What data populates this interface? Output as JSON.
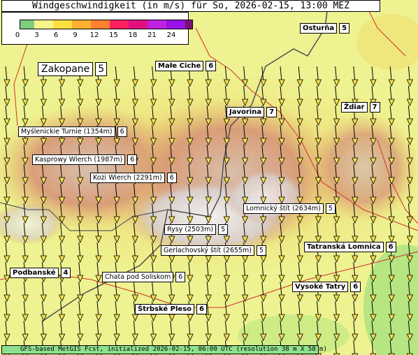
{
  "title": "Windgeschwindigkeit (in m/s) für So, 2026-02-15, 13:00 MEZ",
  "legend": {
    "ticks": [
      "0",
      "3",
      "6",
      "9",
      "12",
      "15",
      "18",
      "21",
      "24"
    ],
    "colors": [
      "#7ccd7c",
      "#f5f58c",
      "#ffe040",
      "#ffb030",
      "#ff8030",
      "#ff2060",
      "#e01080",
      "#c020e0",
      "#9a10e8",
      "#7a1070"
    ]
  },
  "places": [
    {
      "name": "Osturňa",
      "value": "5",
      "type": "town"
    },
    {
      "name": "Małe Ciche",
      "value": "6",
      "type": "town"
    },
    {
      "name": "Zakopane",
      "value": "5",
      "type": "big"
    },
    {
      "name": "Javorina",
      "value": "7",
      "type": "town"
    },
    {
      "name": "Ždiar",
      "value": "7",
      "type": "town"
    },
    {
      "name": "Myślenickie Turnie (1354m)",
      "value": "6",
      "type": "peak"
    },
    {
      "name": "Kasprowy Wierch (1987m)",
      "value": "6",
      "type": "peak"
    },
    {
      "name": "Kozi Wierch (2291m)",
      "value": "6",
      "type": "peak"
    },
    {
      "name": "Lomnický štít (2634m)",
      "value": "5",
      "type": "peak"
    },
    {
      "name": "Rysy (2503m)",
      "value": "5",
      "type": "peak"
    },
    {
      "name": "Gerlachovský štít (2655m)",
      "value": "5",
      "type": "peak"
    },
    {
      "name": "Tatranská Lomnica",
      "value": "6",
      "type": "town"
    },
    {
      "name": "Podbanské",
      "value": "4",
      "type": "town"
    },
    {
      "name": "Chata pod Soliskom",
      "value": "6",
      "type": "peak"
    },
    {
      "name": "Vysoké Tatry",
      "value": "6",
      "type": "town"
    },
    {
      "name": "Štrbské Pleso",
      "value": "6",
      "type": "town"
    }
  ],
  "footer": "GFS-based MetGIS Fcst, initialized 2026-02-15, 06:00 UTC  (resolution 38 m X 58 m)"
}
